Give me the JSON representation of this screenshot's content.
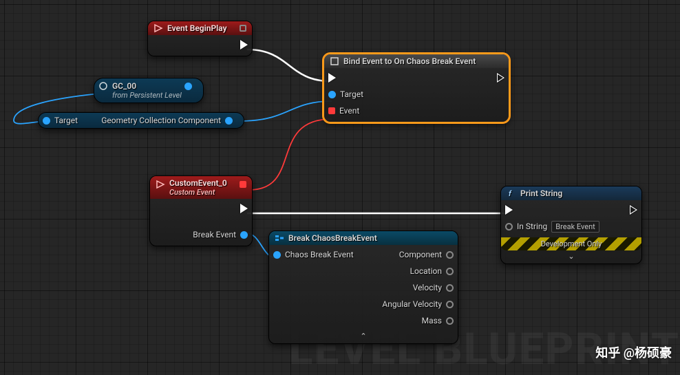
{
  "bg_text": "LEVEL BLUEPRINT",
  "watermark": "知乎 @杨硕豪",
  "nodes": {
    "begin": {
      "title": "Event BeginPlay"
    },
    "gc": {
      "title": "GC_00",
      "subtitle": "from Persistent Level"
    },
    "geo": {
      "in": "Target",
      "out": "Geometry Collection Component"
    },
    "bind": {
      "title": "Bind Event to On Chaos Break Event",
      "target": "Target",
      "event": "Event"
    },
    "custom": {
      "title": "CustomEvent_0",
      "subtitle": "Custom Event",
      "out": "Break Event"
    },
    "break": {
      "title": "Break ChaosBreakEvent",
      "in": "Chaos Break Event",
      "outs": {
        "component": "Component",
        "location": "Location",
        "velocity": "Velocity",
        "angular": "Angular Velocity",
        "mass": "Mass"
      }
    },
    "print": {
      "title": "Print String",
      "in_string": "In String",
      "value": "Break Event",
      "dev": "Development Only"
    }
  }
}
